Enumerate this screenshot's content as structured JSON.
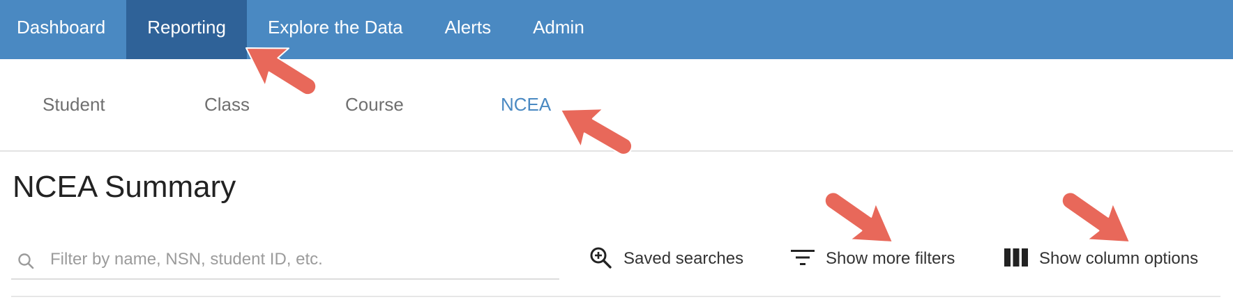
{
  "top_nav": {
    "items": [
      {
        "label": "Dashboard",
        "active": false
      },
      {
        "label": "Reporting",
        "active": true
      },
      {
        "label": "Explore the Data",
        "active": false
      },
      {
        "label": "Alerts",
        "active": false
      },
      {
        "label": "Admin",
        "active": false
      }
    ]
  },
  "sub_nav": {
    "items": [
      {
        "label": "Student",
        "active": false
      },
      {
        "label": "Class",
        "active": false
      },
      {
        "label": "Course",
        "active": false
      },
      {
        "label": "NCEA",
        "active": true
      }
    ]
  },
  "page": {
    "title": "NCEA Summary"
  },
  "search": {
    "placeholder": "Filter by name, NSN, student ID, etc.",
    "value": "",
    "icon": "search-icon"
  },
  "actions": {
    "saved_searches": {
      "label": "Saved searches",
      "icon": "zoom-in-icon"
    },
    "more_filters": {
      "label": "Show more filters",
      "icon": "filter-icon"
    },
    "column_options": {
      "label": "Show column options",
      "icon": "columns-icon"
    }
  },
  "colors": {
    "nav_bg": "#4a89c2",
    "nav_active_bg": "#2f6298",
    "accent": "#4a89c2",
    "annotation_arrow": "#e8685a"
  }
}
